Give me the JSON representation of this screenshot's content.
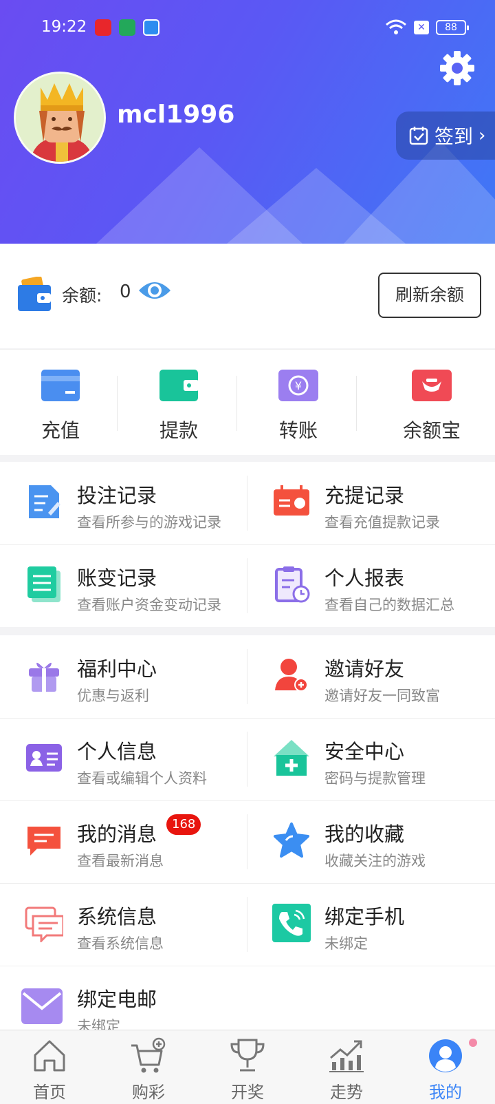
{
  "status_bar": {
    "time": "19:22",
    "battery": "88"
  },
  "profile": {
    "username": "mcl1996",
    "signin_label": "签到"
  },
  "balance": {
    "label": "余额:",
    "value": "0",
    "refresh_label": "刷新余额"
  },
  "quick_actions": [
    {
      "label": "充值",
      "icon": "card-icon"
    },
    {
      "label": "提款",
      "icon": "wallet-icon"
    },
    {
      "label": "转账",
      "icon": "transfer-icon"
    },
    {
      "label": "余额宝",
      "icon": "ingot-icon"
    }
  ],
  "records": [
    {
      "title": "投注记录",
      "subtitle": "查看所参与的游戏记录",
      "icon": "checklist-icon"
    },
    {
      "title": "充提记录",
      "subtitle": "查看充值提款记录",
      "icon": "ticket-icon"
    },
    {
      "title": "账变记录",
      "subtitle": "查看账户资金变动记录",
      "icon": "document-icon"
    },
    {
      "title": "个人报表",
      "subtitle": "查看自己的数据汇总",
      "icon": "clipboard-clock-icon"
    }
  ],
  "menu": [
    {
      "title": "福利中心",
      "subtitle": "优惠与返利",
      "icon": "gift-icon"
    },
    {
      "title": "邀请好友",
      "subtitle": "邀请好友一同致富",
      "icon": "add-user-icon"
    },
    {
      "title": "个人信息",
      "subtitle": "查看或编辑个人资料",
      "icon": "id-card-icon"
    },
    {
      "title": "安全中心",
      "subtitle": "密码与提款管理",
      "icon": "shield-house-icon"
    },
    {
      "title": "我的消息",
      "subtitle": "查看最新消息",
      "icon": "message-icon",
      "badge": "168"
    },
    {
      "title": "我的收藏",
      "subtitle": "收藏关注的游戏",
      "icon": "star-icon"
    },
    {
      "title": "系统信息",
      "subtitle": "查看系统信息",
      "icon": "chat-bubbles-icon"
    },
    {
      "title": "绑定手机",
      "subtitle": "未绑定",
      "icon": "phone-icon"
    },
    {
      "title": "绑定电邮",
      "subtitle": "未绑定",
      "icon": "mail-icon"
    }
  ],
  "bottom_nav": [
    {
      "label": "首页",
      "icon": "home-icon"
    },
    {
      "label": "购彩",
      "icon": "cart-icon"
    },
    {
      "label": "开奖",
      "icon": "trophy-icon"
    },
    {
      "label": "走势",
      "icon": "trend-icon"
    },
    {
      "label": "我的",
      "icon": "user-icon",
      "active": true
    }
  ],
  "colors": {
    "header_start": "#6a4cf2",
    "header_end": "#3f78f6",
    "accent": "#3a84f7",
    "badge": "#e8150e"
  }
}
